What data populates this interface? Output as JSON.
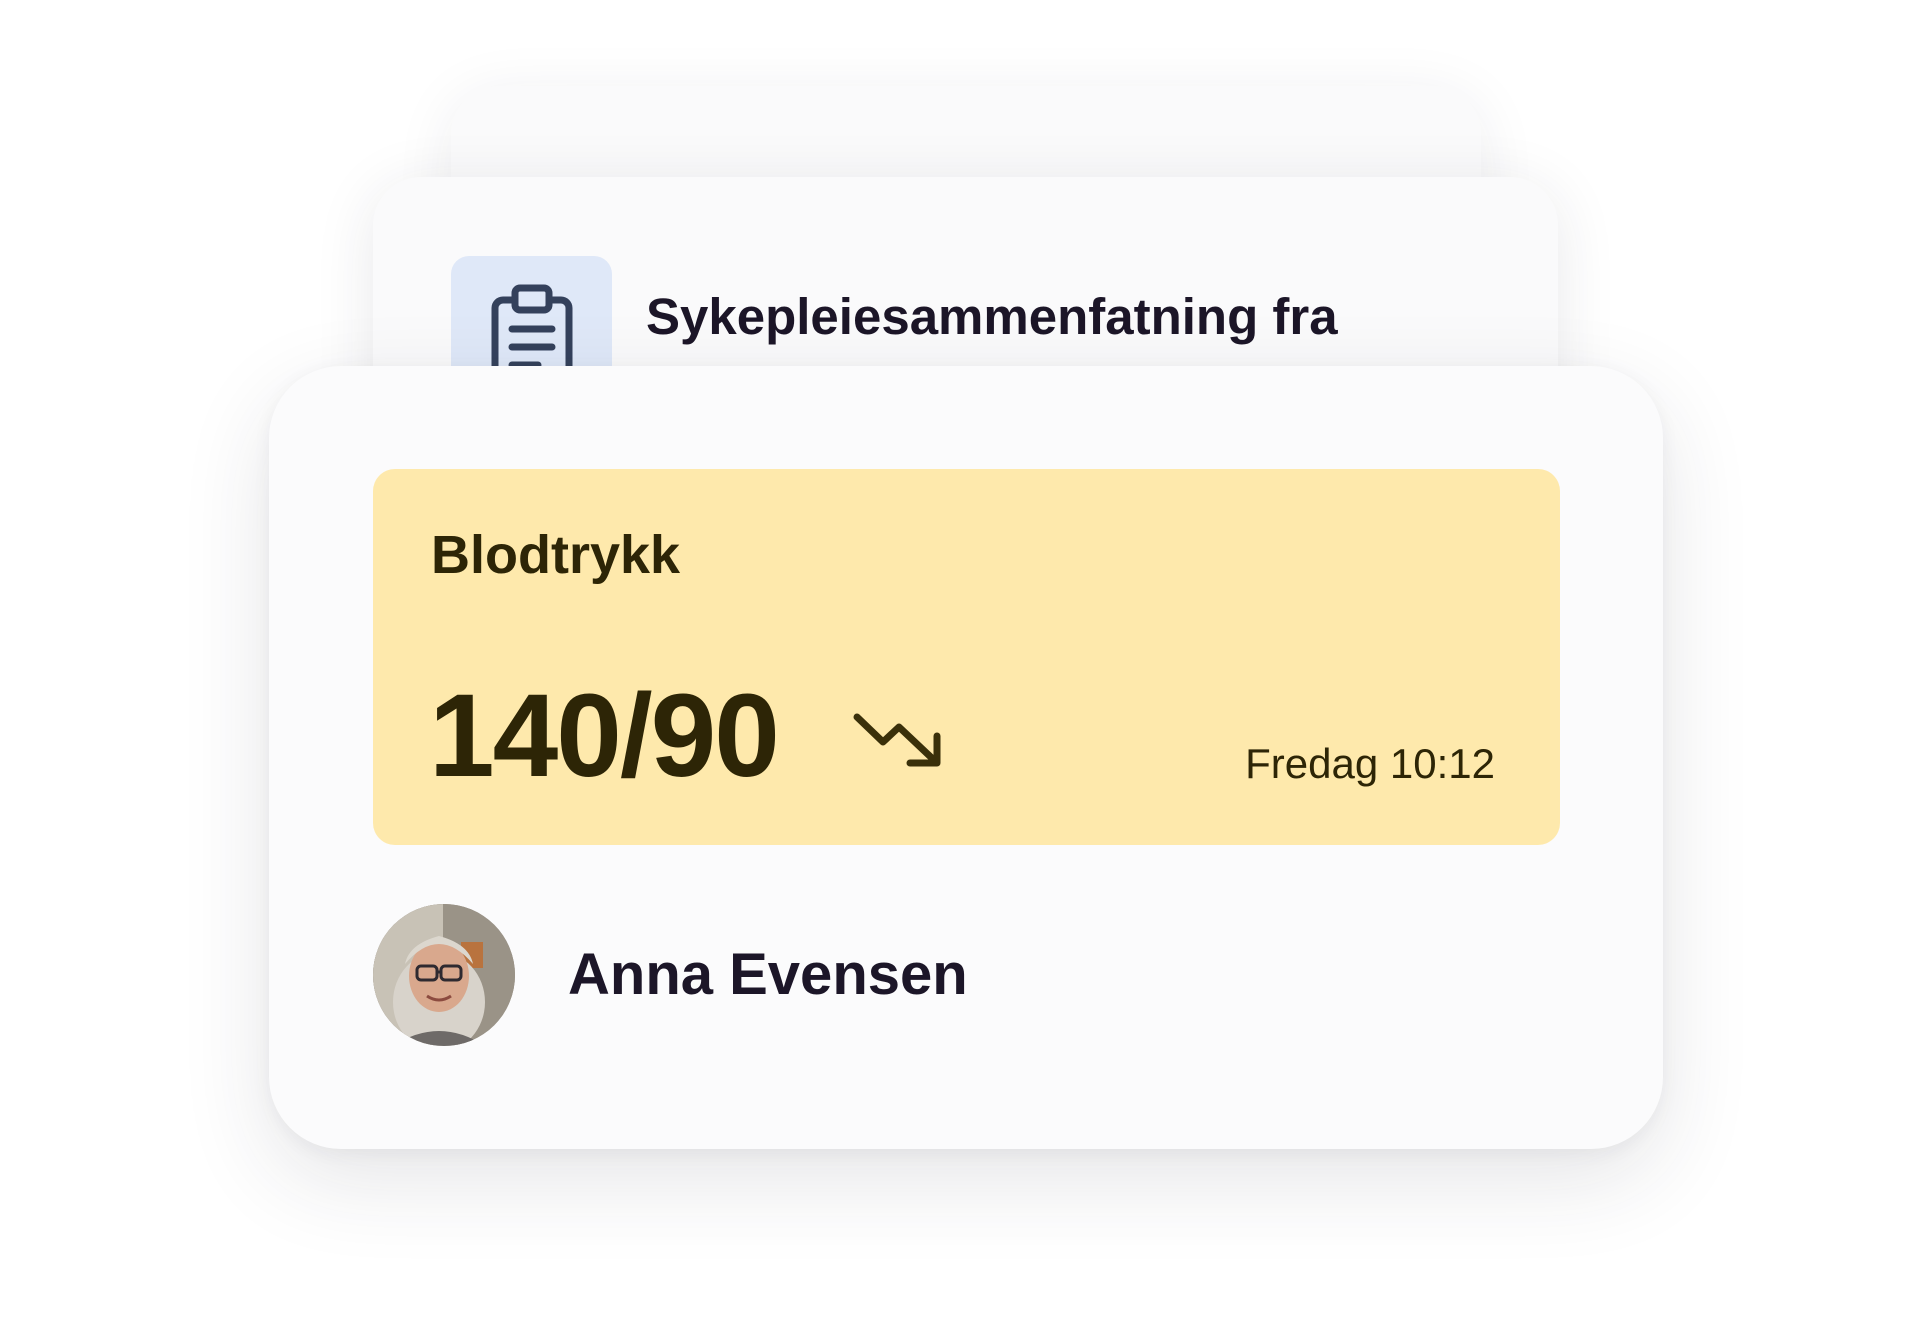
{
  "note_card": {
    "icon": "clipboard-icon",
    "title": "Sykepleiesammenfatning fra"
  },
  "measurement": {
    "label": "Blodtrykk",
    "value": "140/90",
    "trend_icon": "trending-down-icon",
    "time": "Fredag 10:12"
  },
  "person": {
    "name": "Anna Evensen"
  },
  "colors": {
    "metric_panel": "#fee9ac",
    "icon_box": "#dfe8f8",
    "text_dark": "#1c1628",
    "metric_text": "#2d2506"
  }
}
